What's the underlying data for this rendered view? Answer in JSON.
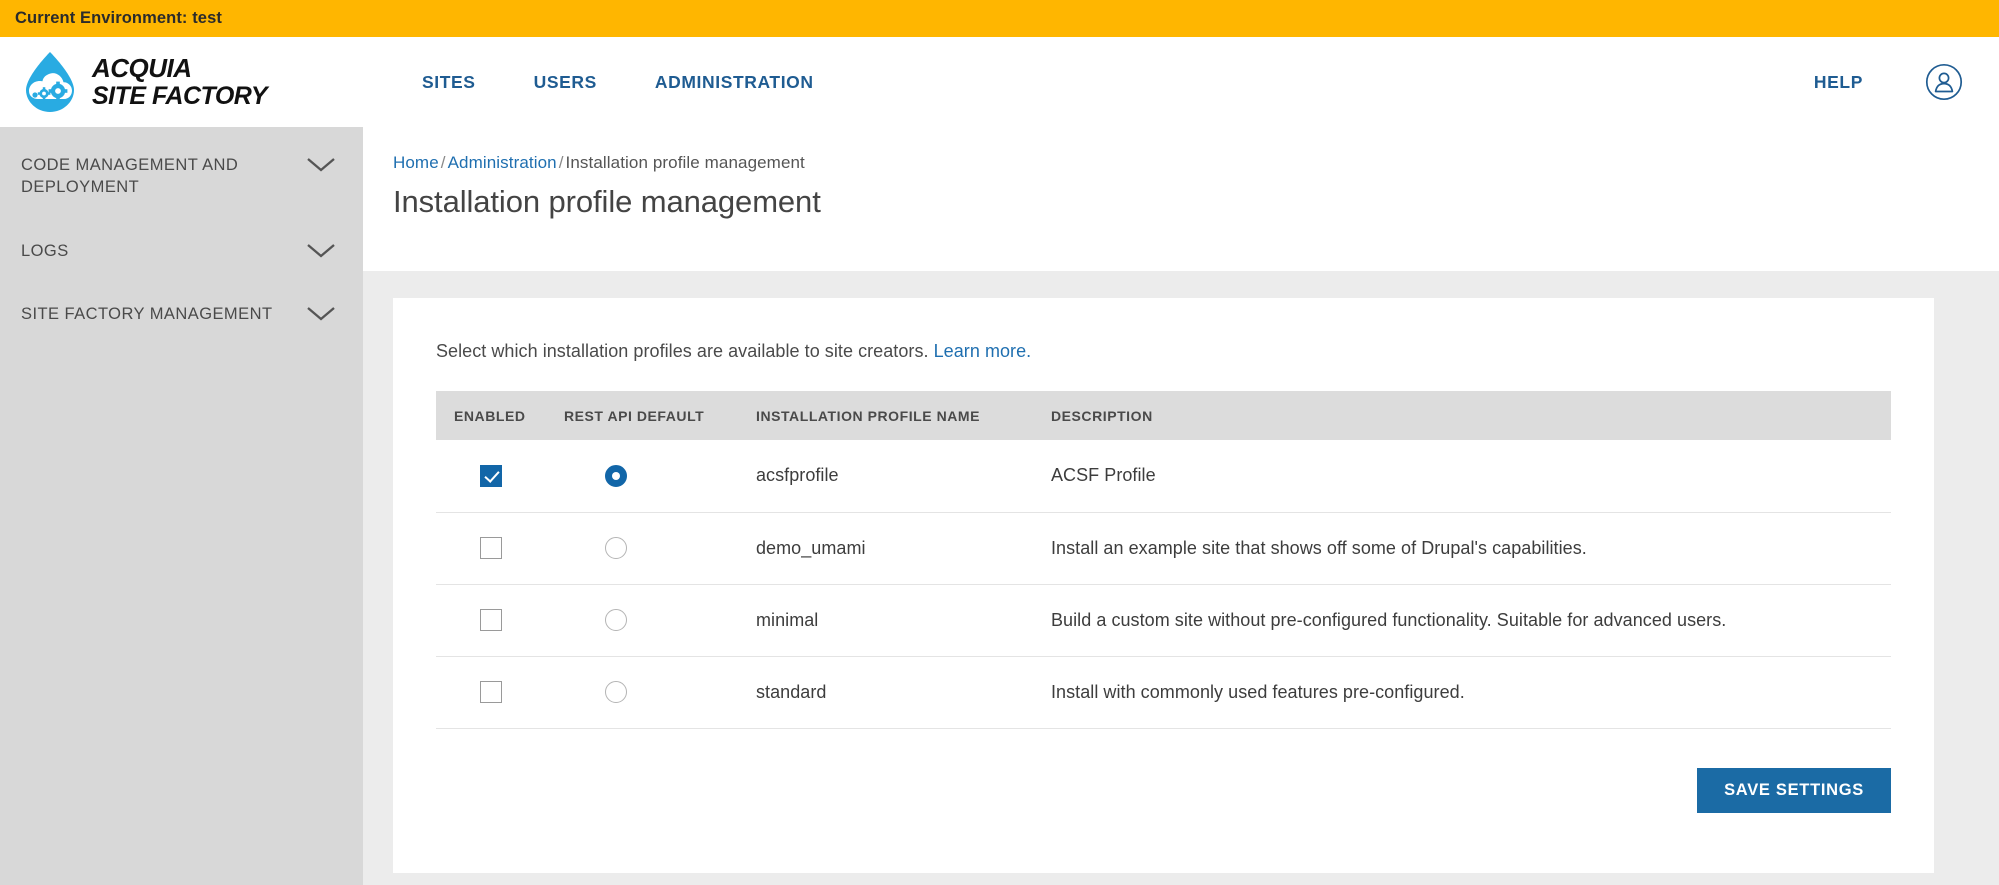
{
  "env_banner": {
    "text": "Current Environment: test",
    "bg": "#FFB600"
  },
  "brand": {
    "line1": "ACQUIA",
    "line2": "SITE FACTORY",
    "logo_icon": "acquia-droplet-cloud-gears-icon",
    "accent": "#29ABE2"
  },
  "top_nav": {
    "items": [
      {
        "label": "SITES"
      },
      {
        "label": "USERS"
      },
      {
        "label": "ADMINISTRATION"
      }
    ],
    "help_label": "HELP",
    "account_icon": "user-avatar-icon",
    "link_color": "#1F5C92"
  },
  "sidebar": {
    "items": [
      {
        "label": "CODE MANAGEMENT AND DEPLOYMENT",
        "icon": "chevron-down-icon"
      },
      {
        "label": "LOGS",
        "icon": "chevron-down-icon"
      },
      {
        "label": "SITE FACTORY MANAGEMENT",
        "icon": "chevron-down-icon"
      }
    ],
    "bg": "#D8D8D8"
  },
  "breadcrumb": {
    "home": "Home",
    "administration": "Administration",
    "current": "Installation profile management",
    "sep": "/"
  },
  "page": {
    "title": "Installation profile management",
    "intro_text": "Select which installation profiles are available to site creators.",
    "intro_link": "Learn more.",
    "link_color": "#1F6FB0"
  },
  "table": {
    "headers": {
      "enabled": "ENABLED",
      "rest_api_default": "REST API DEFAULT",
      "profile_name": "INSTALLATION PROFILE NAME",
      "description": "DESCRIPTION"
    },
    "rows": [
      {
        "enabled": true,
        "rest_api_default": true,
        "name": "acsfprofile",
        "description": "ACSF Profile"
      },
      {
        "enabled": false,
        "rest_api_default": false,
        "name": "demo_umami",
        "description": "Install an example site that shows off some of Drupal's capabilities."
      },
      {
        "enabled": false,
        "rest_api_default": false,
        "name": "minimal",
        "description": "Build a custom site without pre-configured functionality. Suitable for advanced users."
      },
      {
        "enabled": false,
        "rest_api_default": false,
        "name": "standard",
        "description": "Install with commonly used features pre-configured."
      }
    ]
  },
  "actions": {
    "save_label": "SAVE SETTINGS",
    "save_color": "#1B6BA5"
  }
}
